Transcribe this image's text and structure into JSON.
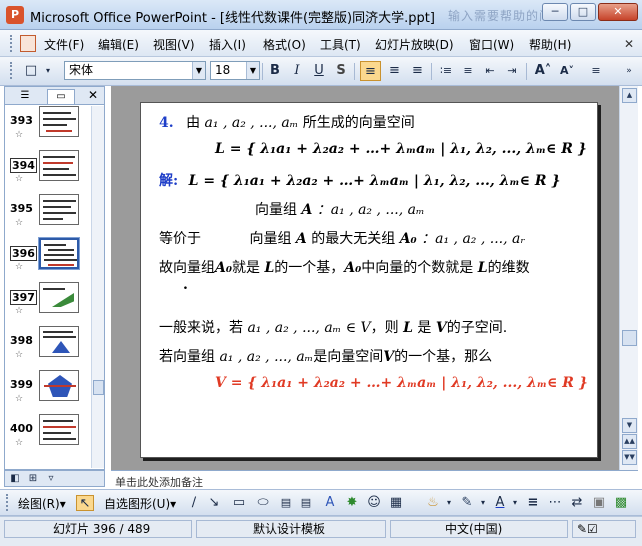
{
  "window": {
    "title": "Microsoft Office PowerPoint - [线性代数课件(完整版)同济大学.ppt]",
    "title_faded": "输入需要帮助的问题",
    "app_icon_letter": "P",
    "minimize": "─",
    "maximize": "□",
    "close": "✕"
  },
  "menubar": {
    "items": [
      "文件(F)",
      "编辑(E)",
      "视图(V)",
      "插入(I)",
      "格式(O)",
      "工具(T)",
      "幻灯片放映(D)",
      "窗口(W)",
      "帮助(H)"
    ],
    "close_label": "✕"
  },
  "toolbar": {
    "font_name": "宋体",
    "font_size": "18",
    "bold": "B",
    "italic": "I",
    "underline": "U",
    "shadow": "S",
    "grow_font": "A˄",
    "shrink_font": "A˅"
  },
  "left_panel": {
    "tab_outline": "☰",
    "tab_slides": "▭",
    "close": "✕",
    "slides": [
      {
        "number": "393",
        "selected": false
      },
      {
        "number": "394",
        "selected": false
      },
      {
        "number": "395",
        "selected": false
      },
      {
        "number": "396",
        "selected": true
      },
      {
        "number": "397",
        "selected": false
      },
      {
        "number": "398",
        "selected": false
      },
      {
        "number": "399",
        "selected": false
      },
      {
        "number": "400",
        "selected": false
      }
    ],
    "star": "☆"
  },
  "slide": {
    "l1_num": "4.",
    "l1_pre": "由",
    "l1_vecs": "a₁ , a₂ , ..., aₘ",
    "l1_post": "所生成的向量空间",
    "l2": "L = { λ₁a₁ + λ₂a₂ + …+ λₘaₘ | λ₁, λ₂, ..., λₘ∈ R }",
    "l3_label": "解:",
    "l3": "L = { λ₁a₁ + λ₂a₂ + …+ λₘaₘ | λ₁, λ₂, ..., λₘ∈ R }",
    "l4_pre": "向量组",
    "l4_sym": "A",
    "l4_post": "：a₁ , a₂ , ..., aₘ",
    "l5_a": "等价于",
    "l5_b": "向量组",
    "l5_c": "A",
    "l5_d": "的最大无关组",
    "l5_e": "A₀",
    "l5_f": "：a₁ , a₂ , ..., aᵣ",
    "l6_a": "故向量组",
    "l6_b": "A₀",
    "l6_c": "就是",
    "l6_d": "L",
    "l6_e": "的一个基，",
    "l6_f": "A₀",
    "l6_g": "中向量的个数就是",
    "l6_h": "L",
    "l6_i": "的维数",
    "l6_dot": ".",
    "l7_a": "一般来说，若",
    "l7_b": "a₁ , a₂ , ..., aₘ ∈ V",
    "l7_c": "，则",
    "l7_d": "L",
    "l7_e": "是",
    "l7_f": "V",
    "l7_g": "的子空间.",
    "l8_a": "若向量组",
    "l8_b": "a₁ , a₂ , ..., aₘ",
    "l8_c": "是向量空间",
    "l8_d": "V",
    "l8_e": "的一个基，那么",
    "l9": "V = { λ₁a₁ + λ₂a₂ + …+ λₘaₘ | λ₁, λ₂, ..., λₘ∈ R }"
  },
  "notes": {
    "text": "单击此处添加备注"
  },
  "drawbar": {
    "draw_label": "绘图(R)▾",
    "autoshape_label": "自选图形(U)▾"
  },
  "statusbar": {
    "slide_info": "幻灯片 396 / 489",
    "template": "默认设计模板",
    "language": "中文(中国)"
  },
  "colors": {
    "accent_blue": "#1e3ec8",
    "formula_red": "#e03a24"
  }
}
